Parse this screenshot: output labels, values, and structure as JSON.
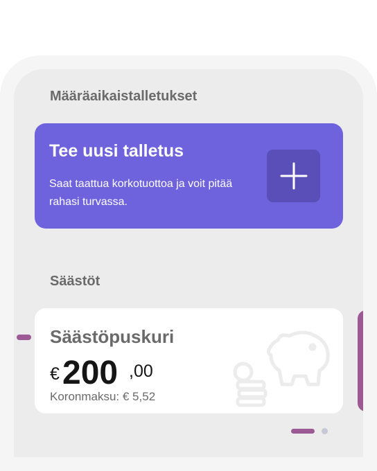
{
  "deposits": {
    "section_title": "Määräaikaistalletukset",
    "card": {
      "title": "Tee uusi talletus",
      "description": "Saat taattua korkotuottoa ja voit pitää rahasi turvassa.",
      "button_icon": "plus-icon",
      "color": "#6f63dd"
    }
  },
  "savings": {
    "section_title": "Säästöt",
    "card": {
      "name": "Säästöpuskuri",
      "currency": "€",
      "amount_integer": "200",
      "amount_decimal": ",00",
      "interest": "Koronmaksu: € 5,52",
      "icon": "piggy-bank-icon",
      "accent_color": "#9c5a95"
    }
  },
  "pager": {
    "pages": 2,
    "active_index": 0
  }
}
